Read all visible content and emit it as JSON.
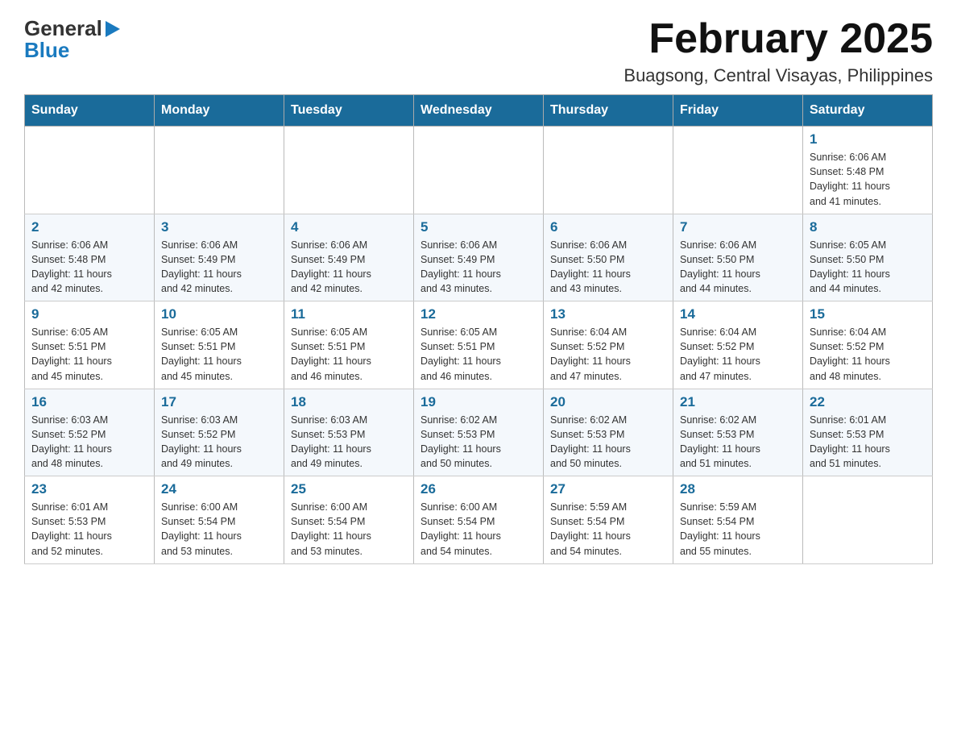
{
  "header": {
    "logo_general": "General",
    "logo_blue": "Blue",
    "title": "February 2025",
    "subtitle": "Buagsong, Central Visayas, Philippines"
  },
  "weekdays": [
    "Sunday",
    "Monday",
    "Tuesday",
    "Wednesday",
    "Thursday",
    "Friday",
    "Saturday"
  ],
  "weeks": [
    [
      {
        "day": "",
        "info": ""
      },
      {
        "day": "",
        "info": ""
      },
      {
        "day": "",
        "info": ""
      },
      {
        "day": "",
        "info": ""
      },
      {
        "day": "",
        "info": ""
      },
      {
        "day": "",
        "info": ""
      },
      {
        "day": "1",
        "info": "Sunrise: 6:06 AM\nSunset: 5:48 PM\nDaylight: 11 hours\nand 41 minutes."
      }
    ],
    [
      {
        "day": "2",
        "info": "Sunrise: 6:06 AM\nSunset: 5:48 PM\nDaylight: 11 hours\nand 42 minutes."
      },
      {
        "day": "3",
        "info": "Sunrise: 6:06 AM\nSunset: 5:49 PM\nDaylight: 11 hours\nand 42 minutes."
      },
      {
        "day": "4",
        "info": "Sunrise: 6:06 AM\nSunset: 5:49 PM\nDaylight: 11 hours\nand 42 minutes."
      },
      {
        "day": "5",
        "info": "Sunrise: 6:06 AM\nSunset: 5:49 PM\nDaylight: 11 hours\nand 43 minutes."
      },
      {
        "day": "6",
        "info": "Sunrise: 6:06 AM\nSunset: 5:50 PM\nDaylight: 11 hours\nand 43 minutes."
      },
      {
        "day": "7",
        "info": "Sunrise: 6:06 AM\nSunset: 5:50 PM\nDaylight: 11 hours\nand 44 minutes."
      },
      {
        "day": "8",
        "info": "Sunrise: 6:05 AM\nSunset: 5:50 PM\nDaylight: 11 hours\nand 44 minutes."
      }
    ],
    [
      {
        "day": "9",
        "info": "Sunrise: 6:05 AM\nSunset: 5:51 PM\nDaylight: 11 hours\nand 45 minutes."
      },
      {
        "day": "10",
        "info": "Sunrise: 6:05 AM\nSunset: 5:51 PM\nDaylight: 11 hours\nand 45 minutes."
      },
      {
        "day": "11",
        "info": "Sunrise: 6:05 AM\nSunset: 5:51 PM\nDaylight: 11 hours\nand 46 minutes."
      },
      {
        "day": "12",
        "info": "Sunrise: 6:05 AM\nSunset: 5:51 PM\nDaylight: 11 hours\nand 46 minutes."
      },
      {
        "day": "13",
        "info": "Sunrise: 6:04 AM\nSunset: 5:52 PM\nDaylight: 11 hours\nand 47 minutes."
      },
      {
        "day": "14",
        "info": "Sunrise: 6:04 AM\nSunset: 5:52 PM\nDaylight: 11 hours\nand 47 minutes."
      },
      {
        "day": "15",
        "info": "Sunrise: 6:04 AM\nSunset: 5:52 PM\nDaylight: 11 hours\nand 48 minutes."
      }
    ],
    [
      {
        "day": "16",
        "info": "Sunrise: 6:03 AM\nSunset: 5:52 PM\nDaylight: 11 hours\nand 48 minutes."
      },
      {
        "day": "17",
        "info": "Sunrise: 6:03 AM\nSunset: 5:52 PM\nDaylight: 11 hours\nand 49 minutes."
      },
      {
        "day": "18",
        "info": "Sunrise: 6:03 AM\nSunset: 5:53 PM\nDaylight: 11 hours\nand 49 minutes."
      },
      {
        "day": "19",
        "info": "Sunrise: 6:02 AM\nSunset: 5:53 PM\nDaylight: 11 hours\nand 50 minutes."
      },
      {
        "day": "20",
        "info": "Sunrise: 6:02 AM\nSunset: 5:53 PM\nDaylight: 11 hours\nand 50 minutes."
      },
      {
        "day": "21",
        "info": "Sunrise: 6:02 AM\nSunset: 5:53 PM\nDaylight: 11 hours\nand 51 minutes."
      },
      {
        "day": "22",
        "info": "Sunrise: 6:01 AM\nSunset: 5:53 PM\nDaylight: 11 hours\nand 51 minutes."
      }
    ],
    [
      {
        "day": "23",
        "info": "Sunrise: 6:01 AM\nSunset: 5:53 PM\nDaylight: 11 hours\nand 52 minutes."
      },
      {
        "day": "24",
        "info": "Sunrise: 6:00 AM\nSunset: 5:54 PM\nDaylight: 11 hours\nand 53 minutes."
      },
      {
        "day": "25",
        "info": "Sunrise: 6:00 AM\nSunset: 5:54 PM\nDaylight: 11 hours\nand 53 minutes."
      },
      {
        "day": "26",
        "info": "Sunrise: 6:00 AM\nSunset: 5:54 PM\nDaylight: 11 hours\nand 54 minutes."
      },
      {
        "day": "27",
        "info": "Sunrise: 5:59 AM\nSunset: 5:54 PM\nDaylight: 11 hours\nand 54 minutes."
      },
      {
        "day": "28",
        "info": "Sunrise: 5:59 AM\nSunset: 5:54 PM\nDaylight: 11 hours\nand 55 minutes."
      },
      {
        "day": "",
        "info": ""
      }
    ]
  ]
}
